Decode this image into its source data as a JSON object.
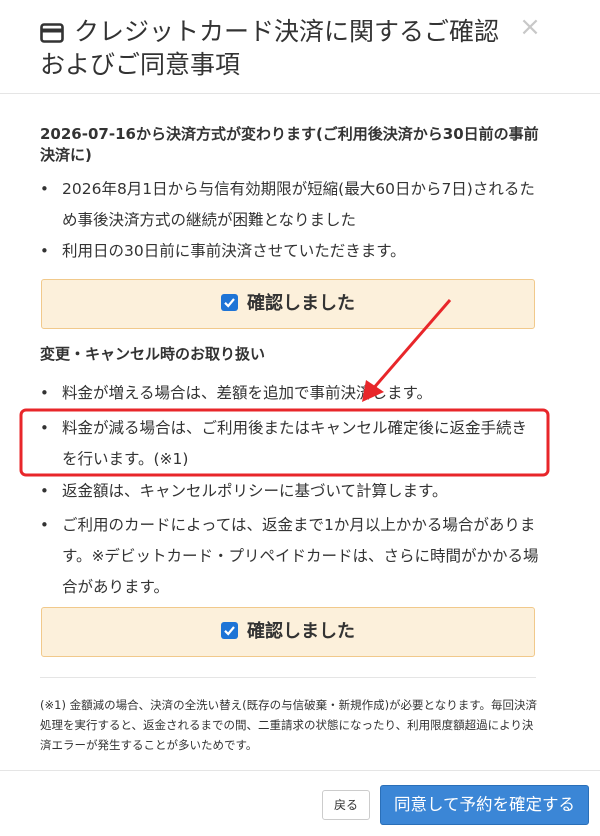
{
  "header": {
    "title": "クレジットカード決済に関するご確認およびご同意事項",
    "close_symbol": "×",
    "icon": "credit-card-icon"
  },
  "section1": {
    "heading": "2026-07-16から決済方式が変わります(ご利用後決済から30日前の事前決済に)",
    "bullets": [
      "2026年8月1日から与信有効期限が短縮(最大60日から7日)されるため事後決済方式の継続が困難となりました",
      "利用日の30日前に事前決済させていただきます。"
    ],
    "confirm_label": "確認しました"
  },
  "section2": {
    "heading": "変更・キャンセル時のお取り扱い",
    "bullets": [
      "料金が増える場合は、差額を追加で事前決済します。",
      "料金が減る場合は、ご利用後またはキャンセル確定後に返金手続きを行います。(※1)",
      "返金額は、キャンセルポリシーに基づいて計算します。",
      "ご利用のカードによっては、返金まで1か月以上かかる場合があります。※デビットカード・プリペイドカードは、さらに時間がかかる場合があります。"
    ],
    "confirm_label": "確認しました"
  },
  "footnote": "(※1) 金額減の場合、決済の全洗い替え(既存の与信破棄・新規作成)が必要となります。毎回決済処理を実行すると、返金されるまでの間、二重請求の状態になったり、利用限度額超過により決済エラーが発生することが多いためです。",
  "footer": {
    "back_label": "戻る",
    "agree_label": "同意して予約を確定する"
  },
  "colors": {
    "confirm_bg": "#fcf0db",
    "confirm_border": "#f1c98b",
    "checkbox": "#1e74d6",
    "primary_button": "#3b86d6",
    "annotation": "#e8262a"
  }
}
